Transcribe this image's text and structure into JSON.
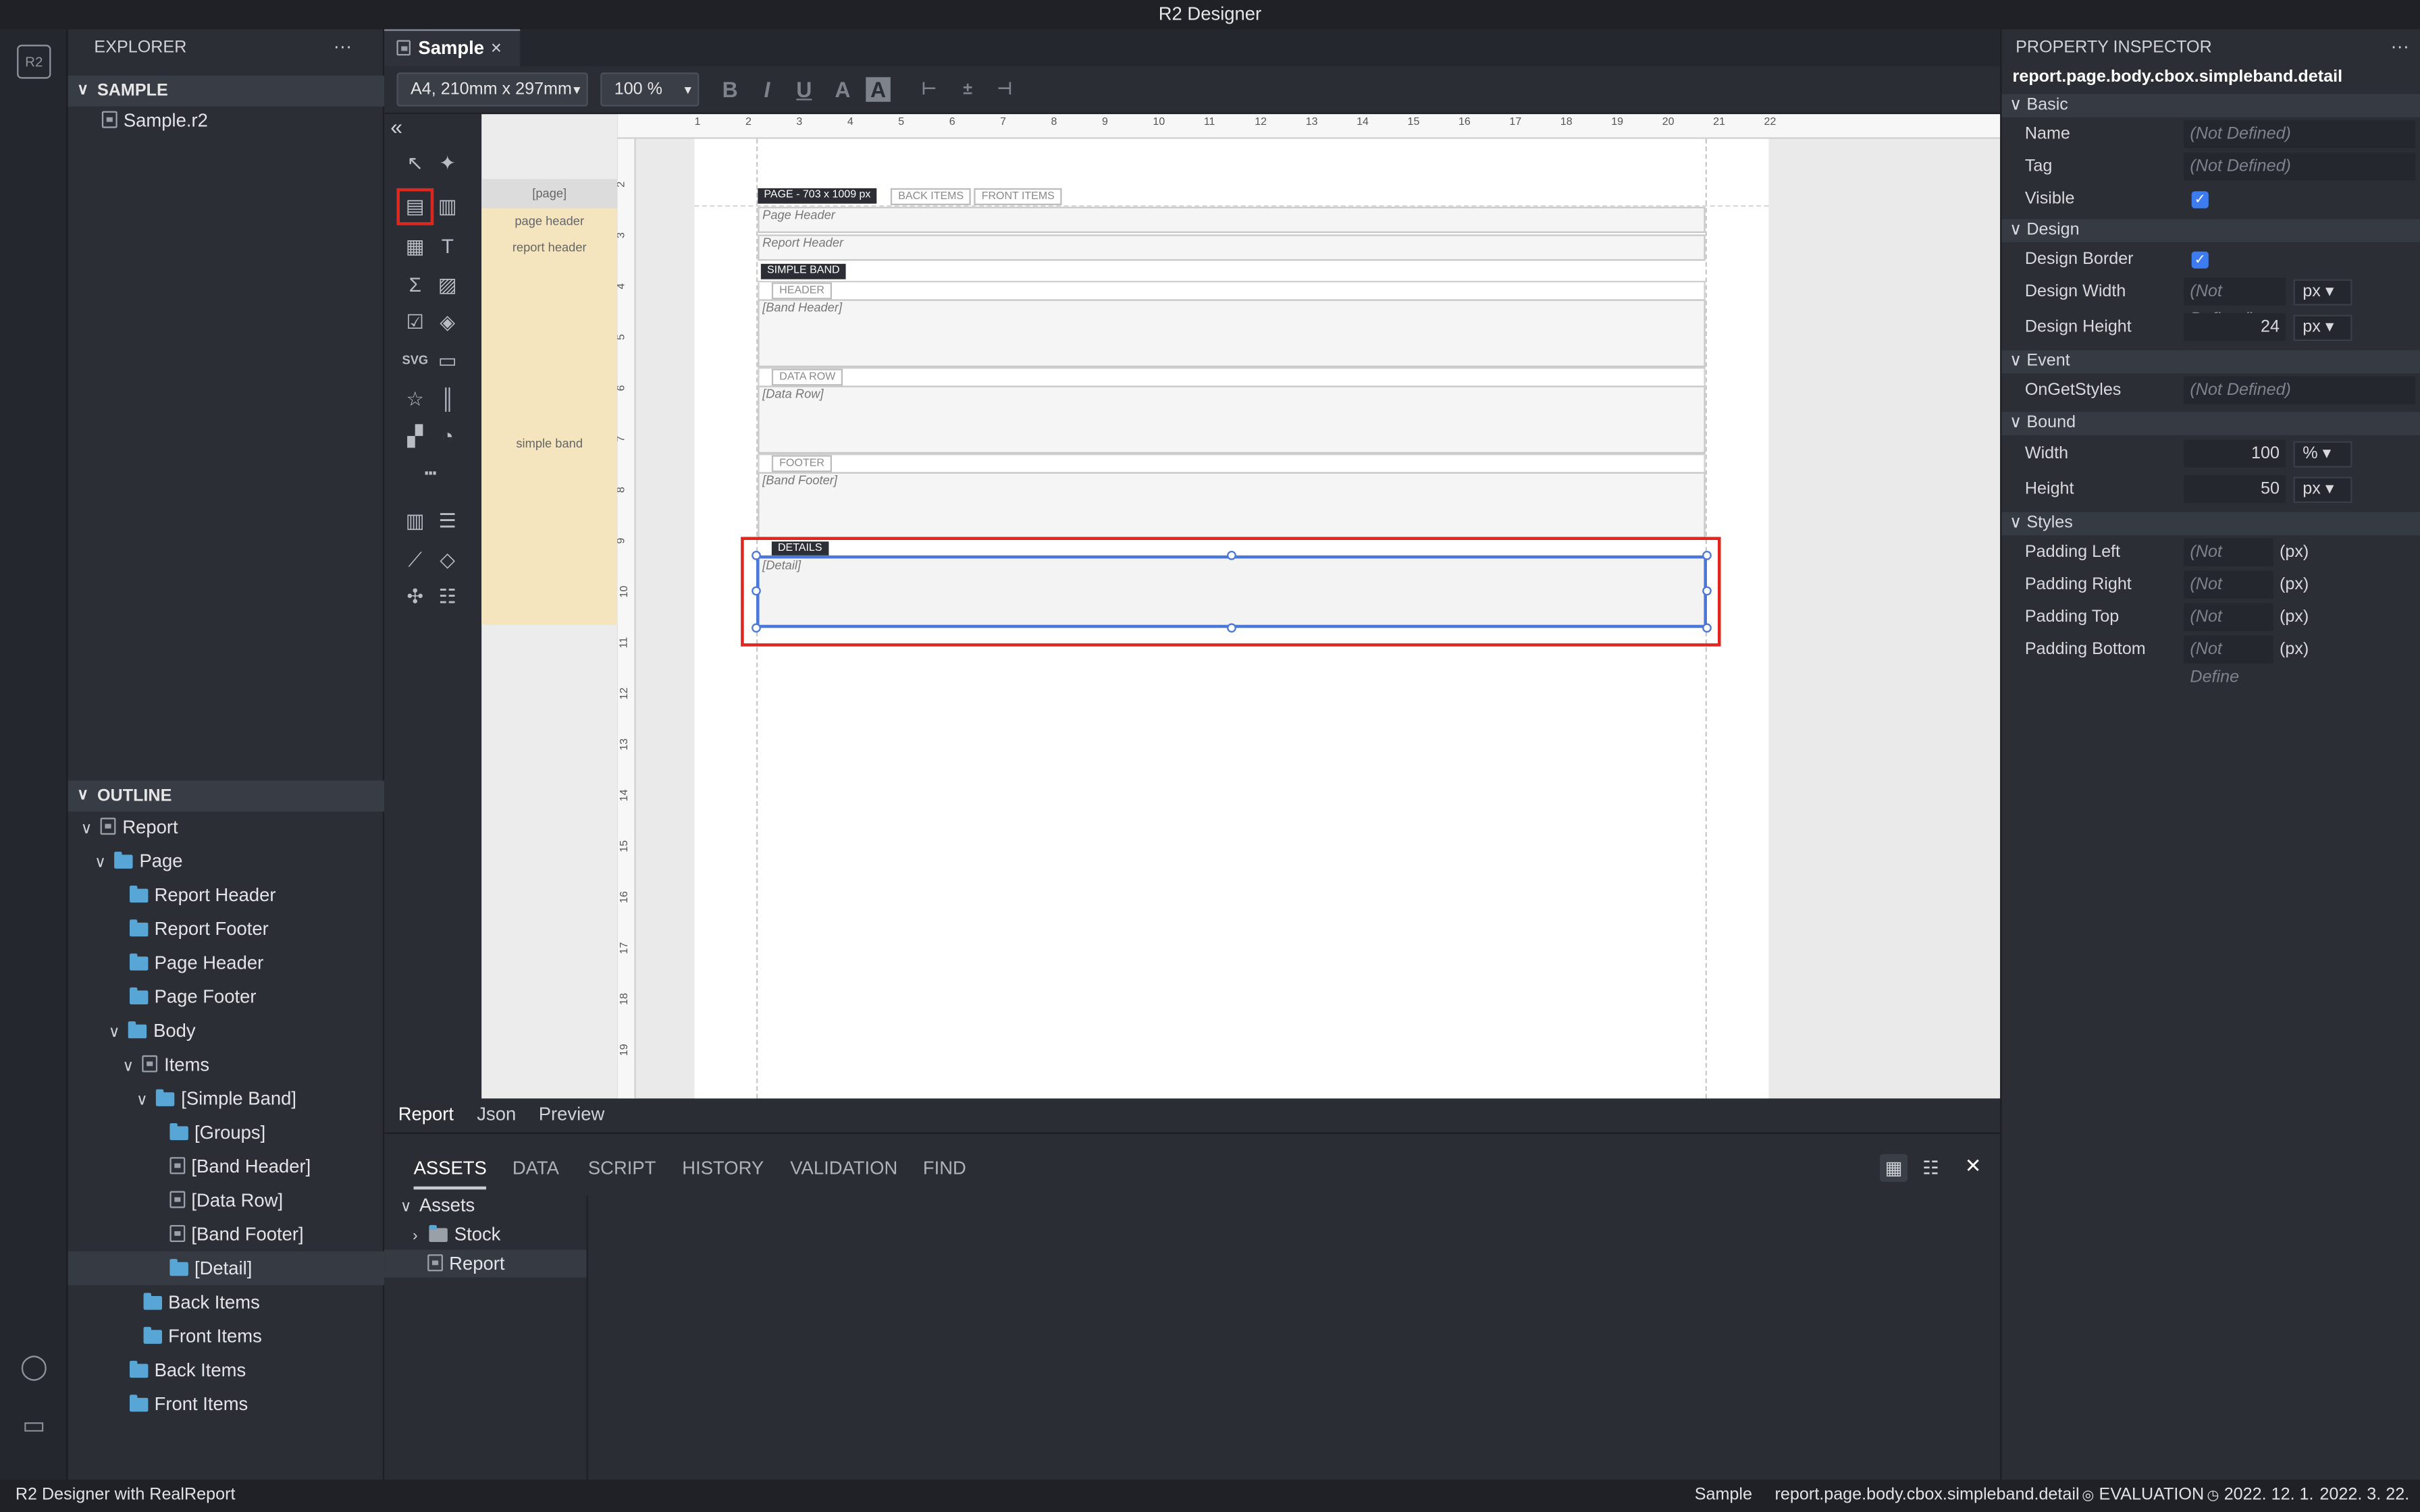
{
  "app": {
    "title": "R2 Designer"
  },
  "explorer": {
    "title": "EXPLORER",
    "more": "···",
    "section": "SAMPLE",
    "file": "Sample.r2"
  },
  "outline": {
    "title": "OUTLINE",
    "items": [
      "Report",
      "Page",
      "Report Header",
      "Report Footer",
      "Page Header",
      "Page Footer",
      "Body",
      "Items",
      "[Simple Band]",
      "[Groups]",
      "[Band Header]",
      "[Data Row]",
      "[Band Footer]",
      "[Detail]",
      "Back Items",
      "Front Items",
      "Back Items",
      "Front Items"
    ]
  },
  "editor": {
    "tab_label": "Sample",
    "tab_close": "×",
    "paper_size": "A4, 210mm x 297mm",
    "zoom": "100 %",
    "collapse": "«"
  },
  "side_labels": {
    "page": "[page]",
    "page_header": "page header",
    "report_header": "report header",
    "simple_band": "simple band"
  },
  "ruler_h": [
    "1",
    "2",
    "3",
    "4",
    "5",
    "6",
    "7",
    "8",
    "9",
    "10",
    "11",
    "12",
    "13",
    "14",
    "15",
    "16",
    "17",
    "18",
    "19",
    "20",
    "21",
    "22"
  ],
  "ruler_v": [
    "2",
    "3",
    "4",
    "5",
    "6",
    "7",
    "8",
    "9",
    "10",
    "11",
    "12",
    "13",
    "14",
    "15",
    "16",
    "17",
    "18",
    "19"
  ],
  "design": {
    "page_tag": "PAGE - 703 x 1009 px",
    "back_items": "BACK ITEMS",
    "front_items": "FRONT ITEMS",
    "page_header": "Page Header",
    "report_header": "Report Header",
    "simple_band": "SIMPLE BAND",
    "header_tag": "HEADER",
    "band_header": "[Band Header]",
    "data_row_tag": "DATA ROW",
    "data_row": "[Data Row]",
    "footer_tag": "FOOTER",
    "band_footer": "[Band Footer]",
    "details_tag": "DETAILS",
    "detail": "[Detail]"
  },
  "view_tabs": [
    "Report",
    "Json",
    "Preview"
  ],
  "panel": {
    "tabs": [
      "ASSETS",
      "DATA",
      "SCRIPT",
      "HISTORY",
      "VALIDATION",
      "FIND"
    ],
    "close": "✕",
    "tree": {
      "root": "Assets",
      "stock": "Stock",
      "report": "Report"
    }
  },
  "inspector": {
    "title": "PROPERTY INSPECTOR",
    "more": "···",
    "path": "report.page.body.cbox.simpleband.detail",
    "groups": {
      "basic": "Basic",
      "design": "Design",
      "event": "Event",
      "bound": "Bound",
      "styles": "Styles"
    },
    "not_defined": "(Not Defined)",
    "not_define_short": "(Not Define",
    "px_unit": "(px)",
    "labels": {
      "name": "Name",
      "tag": "Tag",
      "visible": "Visible",
      "design_border": "Design Border",
      "design_width": "Design Width",
      "design_height": "Design Height",
      "ongetstyles": "OnGetStyles",
      "width": "Width",
      "height": "Height",
      "padding_left": "Padding Left",
      "padding_right": "Padding Right",
      "padding_top": "Padding Top",
      "padding_bottom": "Padding Bottom"
    },
    "values": {
      "design_width_unit": "px",
      "design_height": "24",
      "design_height_unit": "px",
      "width": "100",
      "width_unit": "%",
      "height": "50",
      "height_unit": "px"
    }
  },
  "status": {
    "left": "R2 Designer with RealReport",
    "doc": "Sample",
    "path": "report.page.body.cbox.simpleband.detail",
    "license": "EVALUATION",
    "date1": "2022. 12. 1.",
    "date2": "2022. 3. 22."
  },
  "colors": {
    "accent": "#3d7cf0",
    "highlight": "#e0271f",
    "selection": "#4b78d8"
  }
}
